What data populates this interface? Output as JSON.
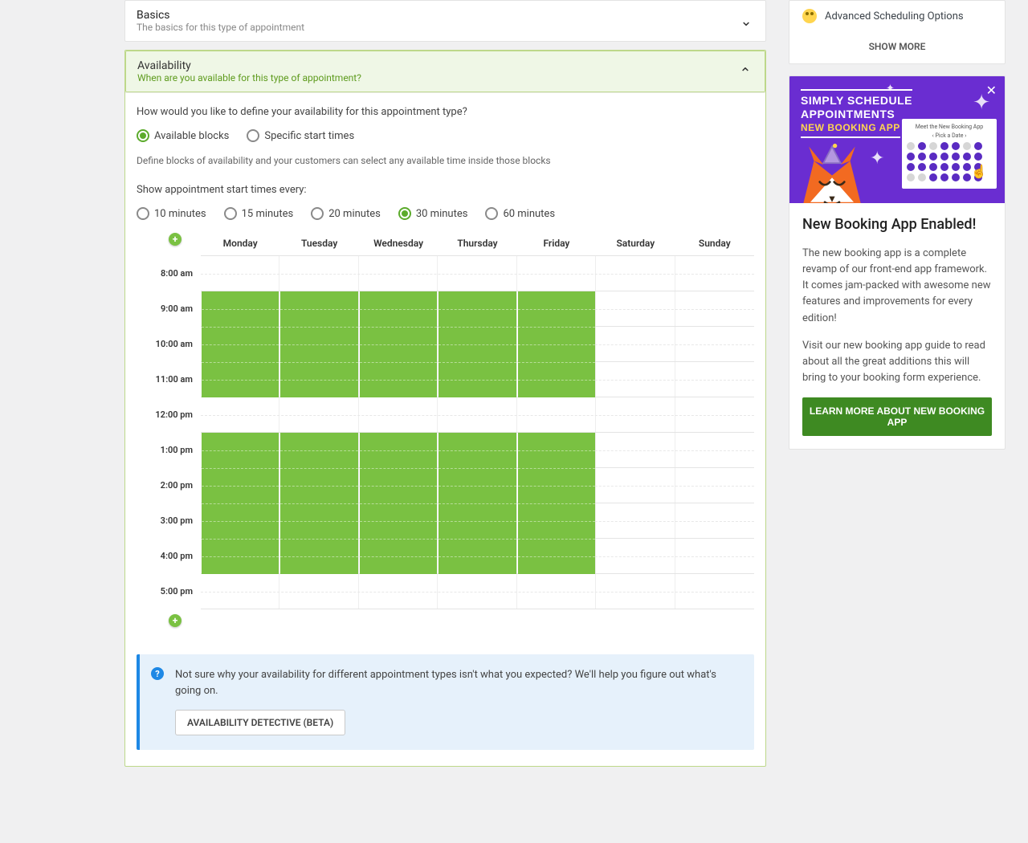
{
  "basics": {
    "title": "Basics",
    "subtitle": "The basics for this type of appointment"
  },
  "availability": {
    "title": "Availability",
    "subtitle": "When are you available for this type of appointment?",
    "prompt": "How would you like to define your availability for this appointment type?",
    "radio_blocks": "Available blocks",
    "radio_times": "Specific start times",
    "helper": "Define blocks of availability and your customers can select any available time inside those blocks",
    "interval_label": "Show appointment start times every:",
    "intervals": {
      "m10": "10 minutes",
      "m15": "15 minutes",
      "m20": "20 minutes",
      "m30": "30 minutes",
      "m60": "60 minutes"
    },
    "days": {
      "mon": "Monday",
      "tue": "Tuesday",
      "wed": "Wednesday",
      "thu": "Thursday",
      "fri": "Friday",
      "sat": "Saturday",
      "sun": "Sunday"
    },
    "hours": {
      "h8": "8:00 am",
      "h9": "9:00 am",
      "h10": "10:00 am",
      "h11": "11:00 am",
      "h12": "12:00 pm",
      "h13": "1:00 pm",
      "h14": "2:00 pm",
      "h15": "3:00 pm",
      "h16": "4:00 pm",
      "h17": "5:00 pm"
    },
    "info_text": "Not sure why your availability for different appointment types isn't what you expected? We'll help you figure out what's going on.",
    "info_button": "AVAILABILITY DETECTIVE (BETA)"
  },
  "sidebar": {
    "option_label": "Advanced Scheduling Options",
    "show_more": "SHOW MORE",
    "promo": {
      "line1": "SIMPLY SCHEDULE",
      "line2": "APPOINTMENTS",
      "line3": "NEW BOOKING APP",
      "mini_title": "Meet the New Booking App",
      "mini_pick": "‹  Pick a Date  ›",
      "title": "New Booking App Enabled!",
      "p1": "The new booking app is a complete revamp of our front-end app framework. It comes jam-packed with awesome new features and improvements for every edition!",
      "p2": "Visit our new booking app guide to read about all the great additions this will bring to your booking form experience.",
      "button": "LEARN MORE ABOUT NEW BOOKING APP"
    }
  }
}
